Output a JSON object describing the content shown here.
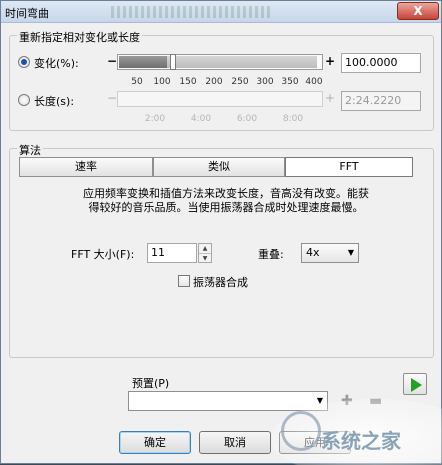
{
  "window": {
    "title": "时间弯曲",
    "close_label": "X"
  },
  "group_length": {
    "title": "重新指定相对变化或长度",
    "change": {
      "label": "变化(%):",
      "minus": "−",
      "plus": "+",
      "ticks": [
        "50",
        "100",
        "150",
        "200",
        "250",
        "300",
        "350",
        "400"
      ],
      "value": "100.0000",
      "selected": true
    },
    "length": {
      "label": "长度(s):",
      "minus": "−",
      "plus": "+",
      "ticks": [
        "2:00",
        "4:00",
        "6:00",
        "8:00"
      ],
      "value": "2:24.2220",
      "selected": false
    }
  },
  "group_algorithm": {
    "title": "算法",
    "tabs": [
      {
        "label": "速率",
        "active": false
      },
      {
        "label": "类似",
        "active": false
      },
      {
        "label": "FFT",
        "active": true
      }
    ],
    "description_line1": "应用频率变换和插值方法来改变长度，音高没有改变。能获",
    "description_line2": "得较好的音乐品质。当使用振荡器合成时处理速度最慢。",
    "fft_size_label": "FFT 大小(F):",
    "fft_size_value": "11",
    "overlap_label": "重叠:",
    "overlap_value": "4x",
    "oscillator_label": "振荡器合成",
    "oscillator_checked": false
  },
  "preset": {
    "label": "预置(P)",
    "value": ""
  },
  "buttons": {
    "ok": "确定",
    "cancel": "取消",
    "apply": "应用"
  },
  "watermark": {
    "text": "系统之家"
  }
}
